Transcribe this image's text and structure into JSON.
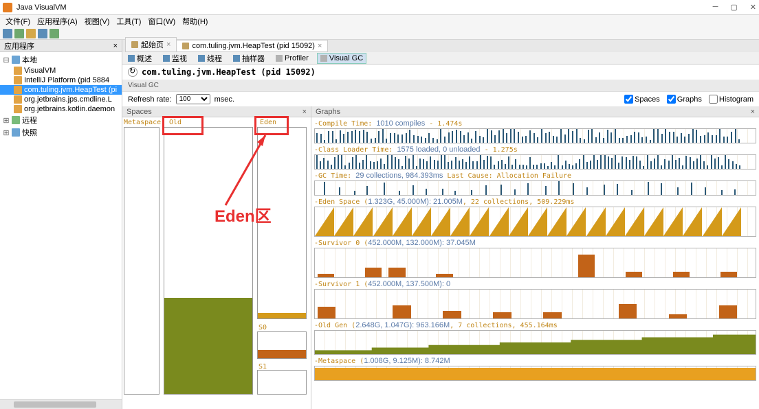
{
  "window": {
    "title": "Java VisualVM"
  },
  "menu": [
    "文件(F)",
    "应用程序(A)",
    "视图(V)",
    "工具(T)",
    "窗口(W)",
    "帮助(H)"
  ],
  "sidebar": {
    "tab": "应用程序",
    "nodes": [
      {
        "label": "本地",
        "exp": "⊟",
        "cls": ""
      },
      {
        "label": "VisualVM",
        "exp": "",
        "cls": ""
      },
      {
        "label": "IntelliJ Platform (pid 5884",
        "exp": "",
        "cls": ""
      },
      {
        "label": "com.tuling.jvm.HeapTest (pi",
        "exp": "",
        "cls": "sel"
      },
      {
        "label": "org.jetbrains.jps.cmdline.L",
        "exp": "",
        "cls": ""
      },
      {
        "label": "org.jetbrains.kotlin.daemon",
        "exp": "",
        "cls": ""
      },
      {
        "label": "远程",
        "exp": "⊞",
        "cls": ""
      },
      {
        "label": "快照",
        "exp": "⊞",
        "cls": ""
      }
    ]
  },
  "tabs": [
    {
      "label": "起始页",
      "active": false
    },
    {
      "label": "com.tuling.jvm.HeapTest (pid 15092)",
      "active": true
    }
  ],
  "subtabs": [
    "概述",
    "监视",
    "线程",
    "抽样器",
    "Profiler",
    "Visual GC"
  ],
  "header": "com.tuling.jvm.HeapTest (pid 15092)",
  "visualgc_label": "Visual GC",
  "refresh": {
    "label": "Refresh rate:",
    "value": "100",
    "unit": "msec."
  },
  "checkboxes": {
    "spaces": "Spaces",
    "graphs": "Graphs",
    "histogram": "Histogram"
  },
  "spaces": {
    "title": "Spaces",
    "labels": {
      "metaspace": "Metaspace",
      "old": "Old",
      "eden": "Eden",
      "s0": "S0",
      "s1": "S1"
    },
    "annotation": "Eden区"
  },
  "graphs": {
    "title": "Graphs",
    "rows": [
      {
        "t1": "Compile Time: ",
        "t2": "1010 compiles",
        "t3": " - 1.474s"
      },
      {
        "t1": "Class Loader Time: ",
        "t2": "1575 loaded, 0 unloaded",
        "t3": " - 1.275s"
      },
      {
        "t1": "GC Time: ",
        "t2": "29 collections, 984.393ms",
        "t3": " Last Cause: Allocation Failure"
      },
      {
        "t1": "Eden Space (",
        "t2": "1.323G, 45.000M): 21.005M",
        "t3": ", 22 collections, 509.229ms"
      },
      {
        "t1": "Survivor 0 (",
        "t2": "452.000M, 132.000M): 37.045M",
        "t3": ""
      },
      {
        "t1": "Survivor 1 (",
        "t2": "452.000M, 137.500M): 0",
        "t3": ""
      },
      {
        "t1": "Old Gen (",
        "t2": "2.648G, 1.047G): 963.166M",
        "t3": ", 7 collections, 455.164ms"
      },
      {
        "t1": "Metaspace (",
        "t2": "1.008G, 9.125M): 8.742M",
        "t3": ""
      }
    ]
  },
  "chart_data": [
    {
      "type": "bar",
      "title": "Compile Time",
      "note": "dense vertical spikes ~1010 compiles over timeline",
      "ylim": [
        0,
        1
      ]
    },
    {
      "type": "bar",
      "title": "Class Loader Time",
      "note": "dense vertical spikes ~1575 events",
      "ylim": [
        0,
        1
      ]
    },
    {
      "type": "bar",
      "title": "GC Time",
      "categories_count": 29,
      "note": "29 sparse spikes",
      "ylim": [
        0,
        1
      ]
    },
    {
      "type": "area",
      "title": "Eden Space",
      "pattern": "sawtooth",
      "cycles": 22,
      "max_mb": 45.0,
      "current_mb": 21.005
    },
    {
      "type": "bar",
      "title": "Survivor 0",
      "values": [
        5,
        0,
        15,
        15,
        0,
        5,
        0,
        0,
        0,
        0,
        0,
        35,
        0,
        8,
        0,
        8,
        0,
        8
      ],
      "current_mb": 37.045,
      "max_mb": 132.0
    },
    {
      "type": "bar",
      "title": "Survivor 1",
      "values": [
        18,
        0,
        0,
        20,
        0,
        12,
        0,
        10,
        0,
        10,
        0,
        0,
        22,
        0,
        6,
        0,
        20
      ],
      "current_mb": 0,
      "max_mb": 137.5
    },
    {
      "type": "area",
      "title": "Old Gen",
      "pattern": "stepped-increase",
      "current_mb": 963.166,
      "max_mb": 1072,
      "steps": 7
    },
    {
      "type": "area",
      "title": "Metaspace",
      "pattern": "flat-high",
      "current_mb": 8.742,
      "max_mb": 9.125
    }
  ]
}
